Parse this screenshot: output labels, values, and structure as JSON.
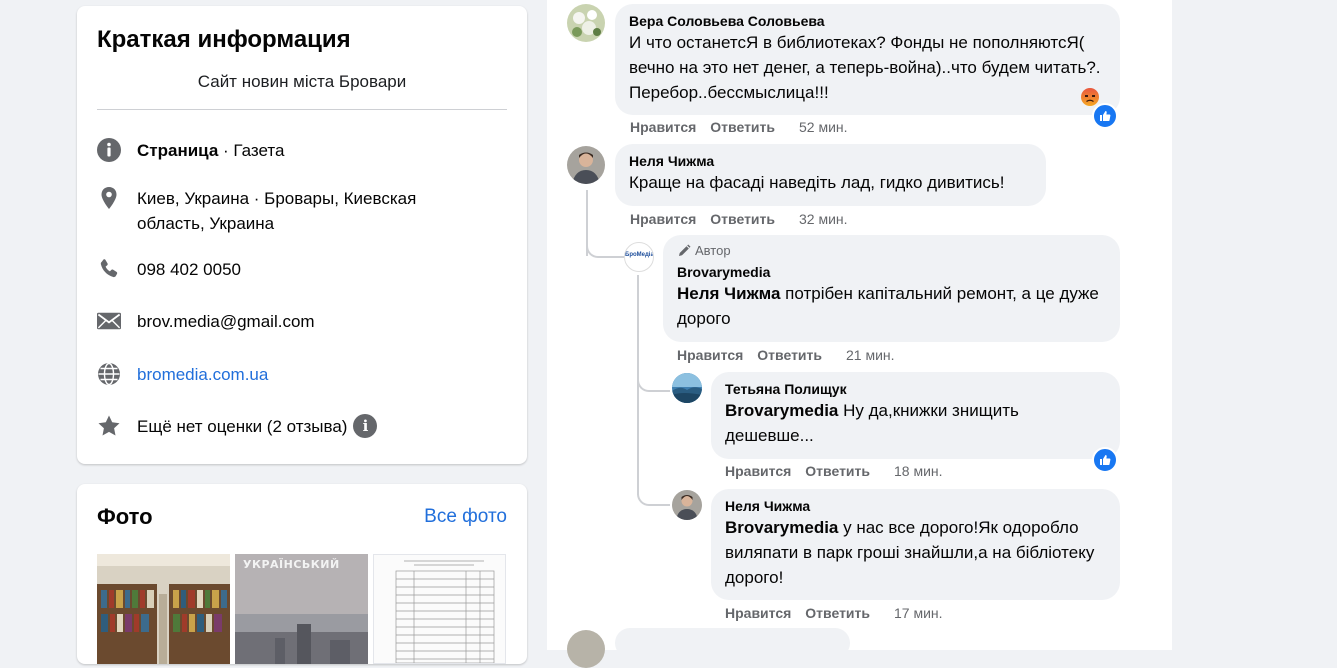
{
  "intro": {
    "title": "Краткая информация",
    "description": "Сайт новин міста Бровари",
    "page_type_bold": "Страница",
    "page_type_rest": " · Газета",
    "address": "Киев, Украина · Бровары, Киевская область, Украина",
    "phone": "098 402 0050",
    "email": "brov.media@gmail.com",
    "website": "bromedia.com.ua",
    "rating": "Ещё нет оценки (2 отзыва)"
  },
  "photos": {
    "title": "Фото",
    "see_all": "Все фото",
    "thumb2_caption": "УКРАЇНСЬКИЙ"
  },
  "comments": [
    {
      "author": "Вера Соловьева Соловьева",
      "text": "И что останетсЯ в библиотеках? Фонды не пополняютсЯ( вечно на это нет денег, а теперь-война)..что будем читать?. Перебор..бессмыслица!!!",
      "like": "Нравится",
      "reply": "Ответить",
      "time": "52 мин."
    },
    {
      "author": "Неля Чижма",
      "text": "Краще на фасаді наведіть лад, гидко дивитись!",
      "like": "Нравится",
      "reply": "Ответить",
      "time": "32 мин."
    },
    {
      "author_badge": "Автор",
      "author": "Brovarymedia",
      "mention": "Неля Чижма",
      "text": " потрібен капітальний ремонт, а це дуже дорого",
      "avatar_label": "БроМедіа",
      "like": "Нравится",
      "reply": "Ответить",
      "time": "21 мин."
    },
    {
      "author": "Тетьяна Полищук",
      "mention": "Brovarymedia",
      "text": " Ну да,книжки знищить дешевше...",
      "like": "Нравится",
      "reply": "Ответить",
      "time": "18 мин."
    },
    {
      "author": "Неля Чижма",
      "mention": "Brovarymedia",
      "text": " у нас все дорого!Як одоробло виляпати в парк гроші знайшли,а на бібліотеку дорого!",
      "like": "Нравится",
      "reply": "Ответить",
      "time": "17 мин."
    }
  ],
  "colors": {
    "link": "#216fdb",
    "facebook_blue": "#1877f2",
    "muted": "#65676b",
    "bubble": "#f0f2f5"
  }
}
